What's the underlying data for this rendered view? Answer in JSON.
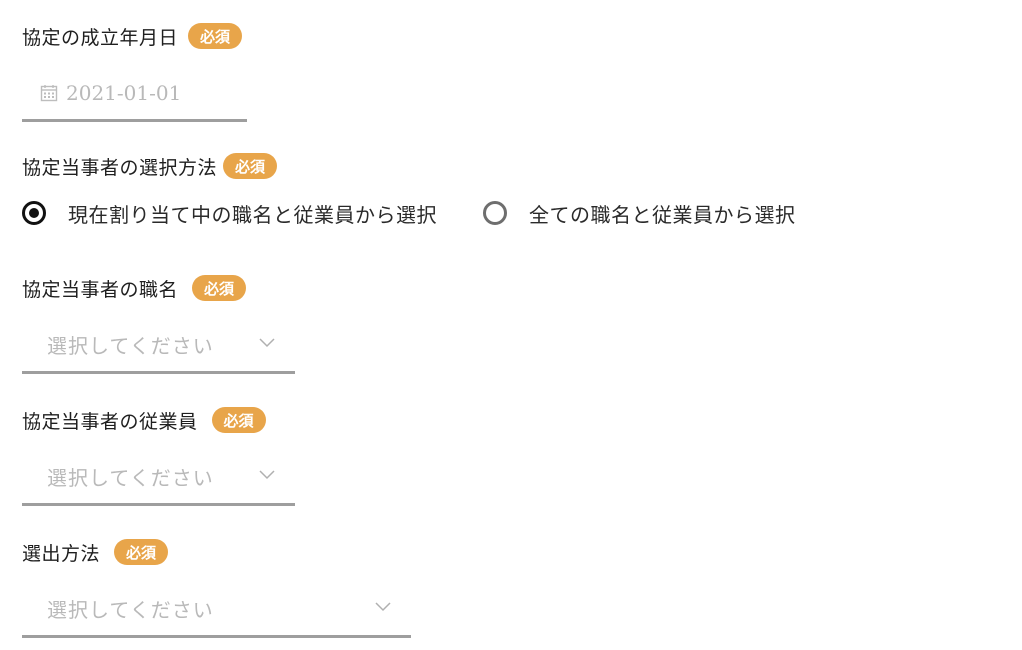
{
  "required_badge": "必須",
  "agreement_date": {
    "label": "協定の成立年月日",
    "placeholder": "2021-01-01"
  },
  "selection_method": {
    "label": "協定当事者の選択方法",
    "options": [
      {
        "label": "現在割り当て中の職名と従業員から選択",
        "selected": true
      },
      {
        "label": "全ての職名と従業員から選択",
        "selected": false
      }
    ]
  },
  "party_job_title": {
    "label": "協定当事者の職名",
    "placeholder": "選択してください"
  },
  "party_employee": {
    "label": "協定当事者の従業員",
    "placeholder": "選択してください"
  },
  "election_method": {
    "label": "選出方法",
    "placeholder": "選択してください"
  },
  "colors": {
    "badge": "#e8a54a",
    "underline": "#9e9e9e",
    "placeholder": "#b9b9b9"
  }
}
